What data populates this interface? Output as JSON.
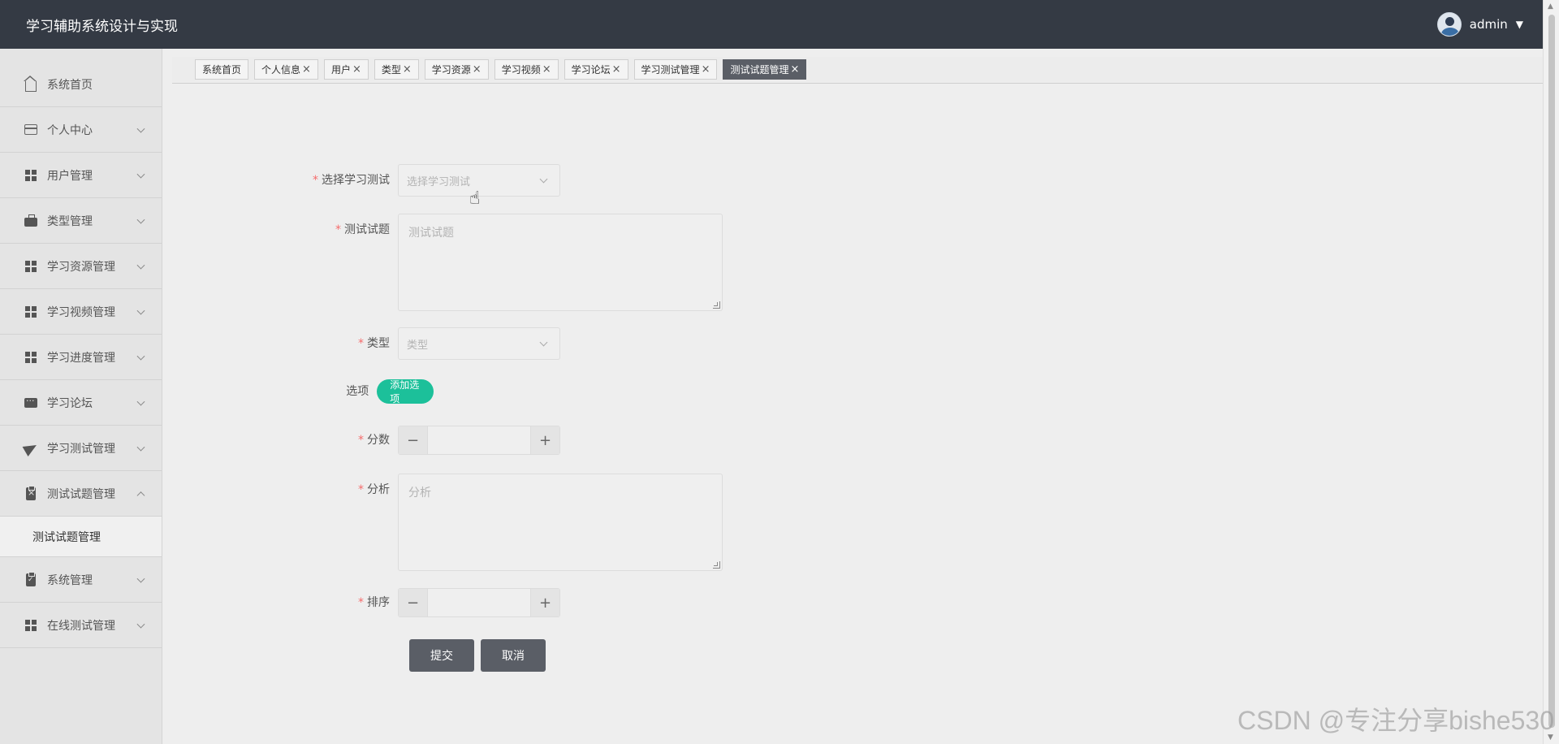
{
  "header": {
    "title": "学习辅助系统设计与实现",
    "username": "admin"
  },
  "sidebar": {
    "items": [
      {
        "label": "系统首页",
        "icon": "home-icon"
      },
      {
        "label": "个人中心",
        "icon": "card-icon"
      },
      {
        "label": "用户管理",
        "icon": "grid-icon"
      },
      {
        "label": "类型管理",
        "icon": "briefcase-icon"
      },
      {
        "label": "学习资源管理",
        "icon": "grid-icon"
      },
      {
        "label": "学习视频管理",
        "icon": "grid-icon"
      },
      {
        "label": "学习进度管理",
        "icon": "grid-icon"
      },
      {
        "label": "学习论坛",
        "icon": "chat-icon"
      },
      {
        "label": "学习测试管理",
        "icon": "paper-plane-icon"
      },
      {
        "label": "测试试题管理",
        "icon": "clipboard-x-icon"
      },
      {
        "label": "系统管理",
        "icon": "clipboard-check-icon"
      },
      {
        "label": "在线测试管理",
        "icon": "grid-icon"
      }
    ],
    "subitem": "测试试题管理"
  },
  "tabs": [
    {
      "label": "系统首页"
    },
    {
      "label": "个人信息"
    },
    {
      "label": "用户"
    },
    {
      "label": "类型"
    },
    {
      "label": "学习资源"
    },
    {
      "label": "学习视频"
    },
    {
      "label": "学习论坛"
    },
    {
      "label": "学习测试管理"
    },
    {
      "label": "测试试题管理"
    }
  ],
  "tab_close": "×",
  "form": {
    "test": {
      "label": "选择学习测试",
      "placeholder": "选择学习测试"
    },
    "question": {
      "label": "测试试题",
      "placeholder": "测试试题"
    },
    "type": {
      "label": "类型",
      "placeholder": "类型"
    },
    "options": {
      "label": "选项",
      "button": "添加选项"
    },
    "score": {
      "label": "分数",
      "minus": "−",
      "plus": "+"
    },
    "analysis": {
      "label": "分析",
      "placeholder": "分析"
    },
    "order": {
      "label": "排序",
      "minus": "−",
      "plus": "+"
    },
    "required_mark": "*",
    "submit": "提交",
    "cancel": "取消"
  },
  "watermark": "CSDN @专注分享bishe530",
  "colors": {
    "header": "#343a44",
    "accent": "#1cc09a",
    "required": "#f56c6c",
    "button": "#5a5e66"
  }
}
